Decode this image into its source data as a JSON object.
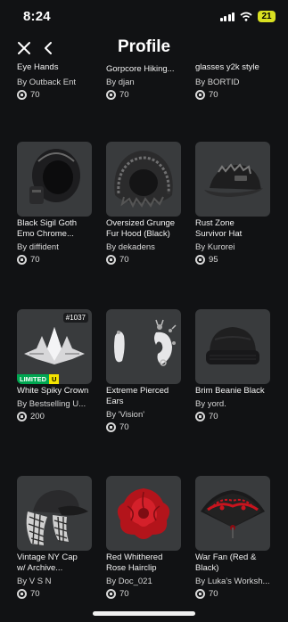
{
  "status": {
    "time": "8:24",
    "battery": "21"
  },
  "header": {
    "title": "Profile"
  },
  "items": [
    {
      "name1": "Eye Hands",
      "name2": "",
      "creator": "By Outback Ent",
      "price": "70"
    },
    {
      "name1": "Gorpcore Hiking...",
      "name2": "",
      "creator": "By djan",
      "price": "70"
    },
    {
      "name1": "glasses y2k style",
      "name2": "",
      "creator": "By BORTID",
      "price": "70"
    },
    {
      "name1": "Black Sigil Goth",
      "name2": "Emo Chrome...",
      "creator": "By diffident",
      "price": "70"
    },
    {
      "name1": "Oversized Grunge",
      "name2": "Fur Hood (Black)",
      "creator": "By dekadens",
      "price": "70"
    },
    {
      "name1": "Rust Zone",
      "name2": "Survivor Hat",
      "creator": "By Kurorei",
      "price": "95"
    },
    {
      "name1": "White Spiky Crown",
      "name2": "",
      "creator": "By Bestselling U...",
      "price": "200",
      "serial": "#1037",
      "limited": "LIMITED",
      "limited_u": "U"
    },
    {
      "name1": "Extreme Pierced",
      "name2": "Ears",
      "creator": "By 'Vision'",
      "price": "70"
    },
    {
      "name1": "Brim Beanie Black",
      "name2": "",
      "creator": "By yord.",
      "price": "70"
    },
    {
      "name1": "Vintage NY Cap",
      "name2": "w/ Archive...",
      "creator": "By V S N",
      "price": "70"
    },
    {
      "name1": "Red Whithered",
      "name2": "Rose Hairclip",
      "creator": "By Doc_021",
      "price": "70"
    },
    {
      "name1": "War Fan (Red &",
      "name2": "Black)",
      "creator": "By Luka's Worksh...",
      "price": "70"
    }
  ]
}
